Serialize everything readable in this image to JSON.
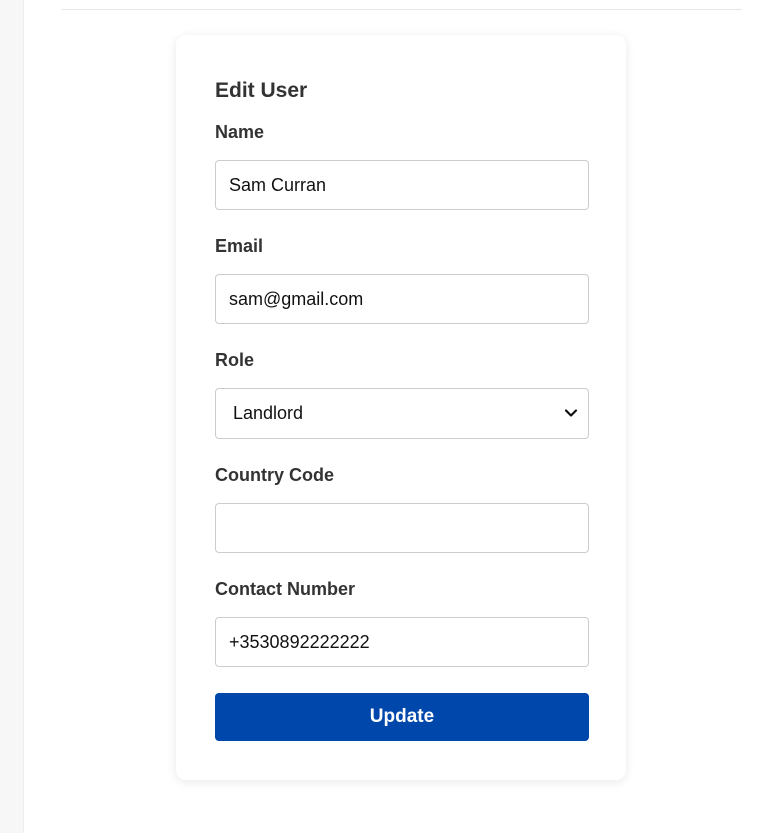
{
  "form": {
    "title": "Edit User",
    "fields": {
      "name": {
        "label": "Name",
        "value": "Sam Curran"
      },
      "email": {
        "label": "Email",
        "value": "sam@gmail.com"
      },
      "role": {
        "label": "Role",
        "value": "Landlord"
      },
      "country_code": {
        "label": "Country Code",
        "value": ""
      },
      "contact_number": {
        "label": "Contact Number",
        "value": "+3530892222222"
      }
    },
    "submit_label": "Update"
  },
  "colors": {
    "primary_button": "#0047ab",
    "card_background": "#ffffff",
    "input_border": "#cccccc",
    "text": "#333333"
  },
  "icons": {
    "role_select": "chevron-down-icon"
  }
}
